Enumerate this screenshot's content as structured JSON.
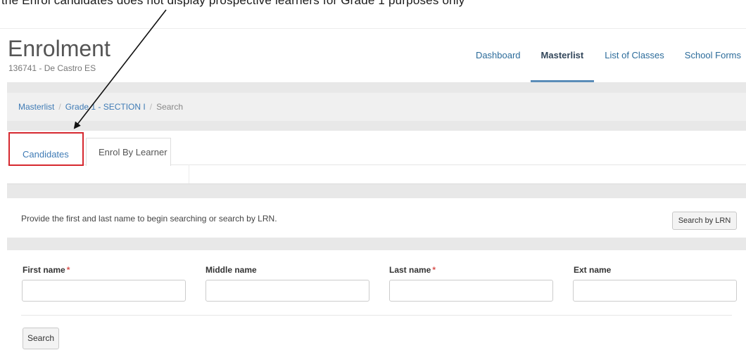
{
  "annotation_text": "the Enrol candidates does not display prospective learners for Grade 1 purposes only",
  "header": {
    "title": "Enrolment",
    "school": "136741 - De Castro ES"
  },
  "nav": {
    "items": [
      {
        "label": "Dashboard",
        "active": false
      },
      {
        "label": "Masterlist",
        "active": true
      },
      {
        "label": "List of Classes",
        "active": false
      },
      {
        "label": "School Forms",
        "active": false
      }
    ]
  },
  "breadcrumb": {
    "items": [
      "Masterlist",
      "Grade 1 - SECTION I"
    ],
    "current": "Search"
  },
  "tabs": {
    "candidates": "Candidates",
    "enrol_by_learner": "Enrol By Learner"
  },
  "search_info": {
    "text": "Provide the first and last name to begin searching or search by LRN.",
    "lrn_button": "Search by LRN"
  },
  "form": {
    "first_name_label": "First name",
    "middle_name_label": "Middle name",
    "last_name_label": "Last name",
    "ext_name_label": "Ext name",
    "required_marker": "*",
    "first_name_value": "",
    "middle_name_value": "",
    "last_name_value": "",
    "ext_name_value": "",
    "search_button": "Search"
  },
  "colors": {
    "link": "#3f7bb5",
    "nav_active_underline": "#5b8db8",
    "highlight": "#d6282f",
    "required": "#d9534f"
  }
}
